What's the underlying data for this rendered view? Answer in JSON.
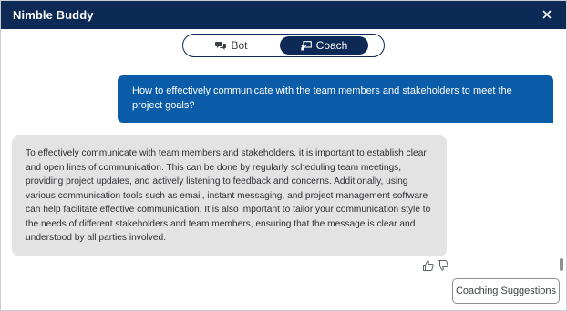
{
  "app": {
    "title": "Nimble Buddy"
  },
  "mode_toggle": {
    "options": [
      {
        "label": "Bot",
        "icon": "chat-bubbles-icon"
      },
      {
        "label": "Coach",
        "icon": "coach-presentation-icon"
      }
    ],
    "selected": "Coach"
  },
  "conversation": {
    "user_message": "How to effectively communicate with the team members and stakeholders to meet the project goals?",
    "bot_message": "To effectively communicate with team members and stakeholders, it is important to establish clear and open lines of communication. This can be done by regularly scheduling team meetings, providing project updates, and actively listening to feedback and concerns. Additionally, using various communication tools such as email, instant messaging, and project management software can help facilitate effective communication. It is also important to tailor your communication style to the needs of different stakeholders and team members, ensuring that the message is clear and understood by all parties involved."
  },
  "actions": {
    "coaching_suggestions_label": "Coaching Suggestions"
  },
  "colors": {
    "header_bg": "#0d2a56",
    "user_bubble": "#0a5ba8",
    "bot_bubble": "#e3e3e3"
  }
}
